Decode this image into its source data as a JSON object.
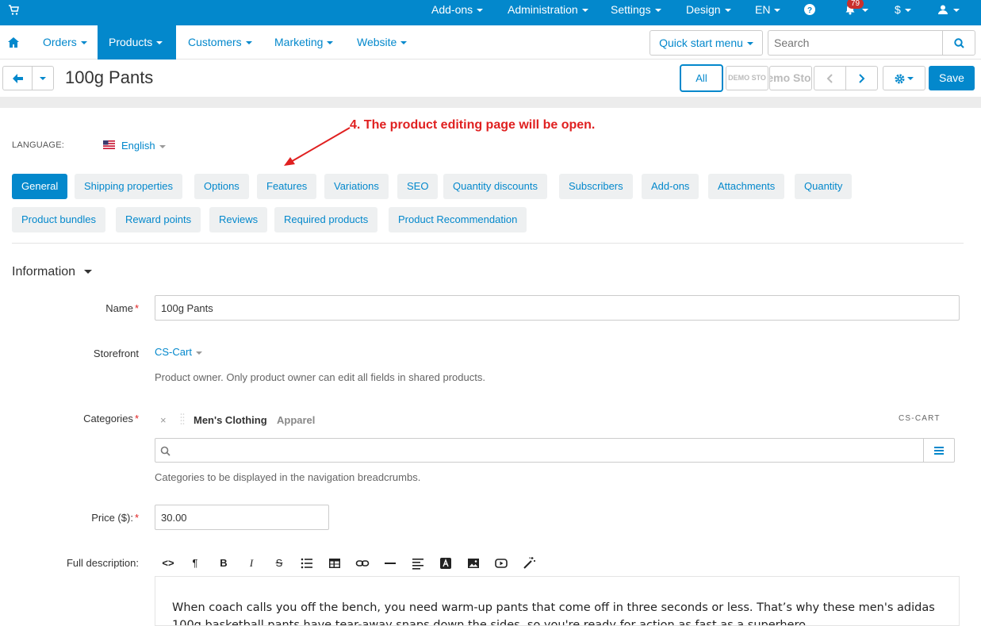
{
  "topbar": {
    "nav": [
      "Add-ons",
      "Administration",
      "Settings",
      "Design",
      "EN"
    ],
    "notification_count": "79",
    "currency": "$"
  },
  "navbar": {
    "items": [
      "Orders",
      "Products",
      "Customers",
      "Marketing",
      "Website"
    ],
    "active": "Products",
    "quick_start": "Quick start menu",
    "search_placeholder": "Search"
  },
  "titlebar": {
    "title": "100g Pants",
    "all_label": "All",
    "store1": "DEMO STO",
    "store2": "emo Sto",
    "save_label": "Save"
  },
  "annotation": "4. The product editing page will be open.",
  "language": {
    "label": "LANGUAGE:",
    "value": "English"
  },
  "tabs": {
    "row1": [
      "General",
      "Shipping properties",
      "Options",
      "Features",
      "Variations",
      "SEO",
      "Quantity discounts",
      "Subscribers",
      "Add-ons",
      "Attachments",
      "Quantity"
    ],
    "row2": [
      "Product bundles",
      "Reward points",
      "Reviews",
      "Required products",
      "Product Recommendation"
    ],
    "active": "General"
  },
  "section": {
    "title": "Information"
  },
  "form": {
    "name_label": "Name",
    "name_value": "100g Pants",
    "storefront_label": "Storefront",
    "storefront_value": "CS-Cart",
    "storefront_help": "Product owner. Only product owner can edit all fields in shared products.",
    "categories_label": "Categories",
    "category_name": "Men's Clothing",
    "category_parent": "Apparel",
    "category_store": "CS-CART",
    "categories_help": "Categories to be displayed in the navigation breadcrumbs.",
    "price_label": "Price ($):",
    "price_value": "30.00",
    "description_label": "Full description:",
    "description_text": "When coach calls you off the bench, you need warm-up pants that come off in three seconds or less. That’s why these men's adidas 100g basketball pants have tear-away snaps down the sides, so you're ready for action as fast as a superhero."
  },
  "colors": {
    "brand": "#0388cc",
    "required": "#e02020",
    "annotation": "#e02020"
  }
}
